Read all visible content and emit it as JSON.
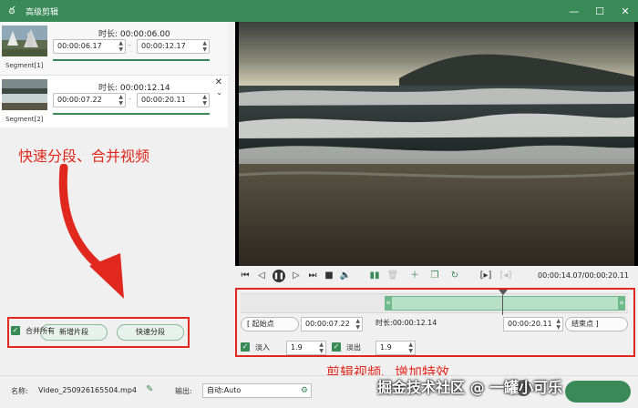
{
  "window": {
    "title": "高级剪辑",
    "controls": {
      "minimize": "—",
      "maximize": "☐",
      "close": "✕"
    }
  },
  "segments": [
    {
      "label": "Segment[1]",
      "duration_label": "时长:",
      "duration": "00:00:06.00",
      "start": "00:00:06.17",
      "end": "00:00:12.17",
      "separator": "-"
    },
    {
      "label": "Segment[2]",
      "duration_label": "时长:",
      "duration": "00:00:12.14",
      "start": "00:00:07.22",
      "end": "00:00:20.11",
      "separator": "-"
    }
  ],
  "annotations": {
    "left": "快速分段、合并视频",
    "right": "剪辑视频、增加特效"
  },
  "left_actions": {
    "add_segment": "新增片段",
    "quick_split": "快速分段",
    "merge_all": "合并所有",
    "merge_all_checked": true
  },
  "player": {
    "timecode": "00:00:14.07/00:00:20.11"
  },
  "editor": {
    "start_btn": "[   起始点",
    "start_value": "00:00:07.22",
    "duration_label": "时长:",
    "duration_value": "00:00:12.14",
    "end_value": "00:00:20.11",
    "end_btn": "结束点   ]",
    "fade_in_label": "淡入",
    "fade_in_value": "1.9",
    "fade_out_label": "淡出",
    "fade_out_value": "1.9"
  },
  "bottom": {
    "name_label": "名称:",
    "file_name": "Video_250926165504.mp4",
    "output_label": "输出:",
    "output_value": "自动:Auto"
  },
  "watermark": "掘金技术社区 @ 一罐小可乐",
  "colors": {
    "accent": "#3a8a58",
    "annotation": "#e0281e"
  }
}
